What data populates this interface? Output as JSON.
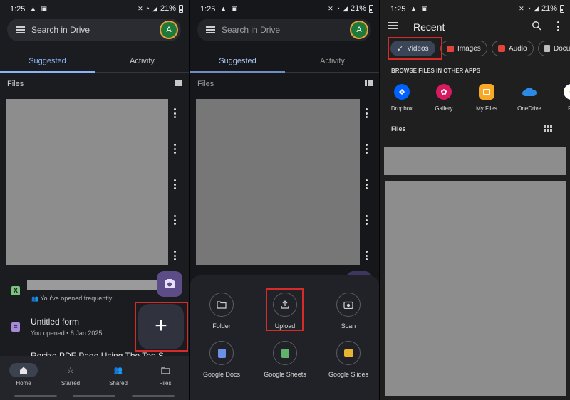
{
  "status": {
    "time": "1:25",
    "battery": "21%"
  },
  "panel1": {
    "search_placeholder": "Search in Drive",
    "avatar_letter": "A",
    "tabs": [
      {
        "label": "Suggested"
      },
      {
        "label": "Activity"
      }
    ],
    "files_header": "Files",
    "rows": [
      {
        "subtitle": "You've opened frequently",
        "icon": "sheets-icon"
      },
      {
        "title": "Untitled form",
        "subtitle": "You opened • 8 Jan 2025",
        "icon": "forms-icon"
      },
      {
        "title": "Resize PDF Page Using The Top S..."
      }
    ],
    "fab_label": "+",
    "bottom_nav": [
      {
        "label": "Home"
      },
      {
        "label": "Starred"
      },
      {
        "label": "Shared"
      },
      {
        "label": "Files"
      }
    ]
  },
  "panel2": {
    "search_placeholder": "Search in Drive",
    "avatar_letter": "A",
    "tabs": [
      {
        "label": "Suggested"
      },
      {
        "label": "Activity"
      }
    ],
    "files_header": "Files",
    "options": [
      {
        "label": "Folder",
        "icon": "folder-icon"
      },
      {
        "label": "Upload",
        "icon": "upload-icon"
      },
      {
        "label": "Scan",
        "icon": "camera-icon"
      },
      {
        "label": "Google Docs",
        "icon": "docs-icon"
      },
      {
        "label": "Google Sheets",
        "icon": "sheets-icon"
      },
      {
        "label": "Google Slides",
        "icon": "slides-icon"
      }
    ]
  },
  "panel3": {
    "title": "Recent",
    "chips": [
      {
        "label": "Videos"
      },
      {
        "label": "Images"
      },
      {
        "label": "Audio"
      },
      {
        "label": "Docu"
      }
    ],
    "browse_header": "BROWSE FILES IN OTHER APPS",
    "apps": [
      {
        "label": "Dropbox",
        "color": "#0061fe"
      },
      {
        "label": "Gallery",
        "color": "#d81b60"
      },
      {
        "label": "My Files",
        "color": "#f9a825"
      },
      {
        "label": "OneDrive",
        "color": "#ffffff"
      },
      {
        "label": "Ph",
        "color": "#ffffff"
      }
    ],
    "files_header": "Files"
  },
  "colors": {
    "accent": "#8ab4f8",
    "highlight": "#d92a2a",
    "fab_purple": "#5c4d88"
  }
}
